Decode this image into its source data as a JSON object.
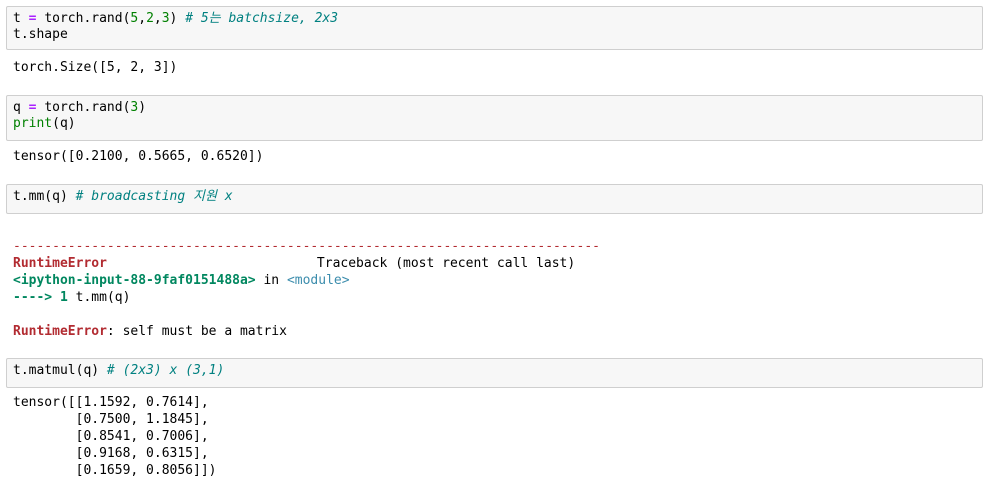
{
  "cells": [
    {
      "input": {
        "line1": {
          "var": "t",
          "eq": "=",
          "call": "torch.rand(",
          "a": "5",
          "c1": ",",
          "b": "2",
          "c2": ",",
          "c": "3",
          "close": ")",
          "comment": "# 5는 batchsize, 2x3"
        },
        "line2": "t.shape"
      },
      "output": "torch.Size([5, 2, 3])"
    },
    {
      "input": {
        "line1": {
          "var": "q",
          "eq": "=",
          "call": "torch.rand(",
          "a": "3",
          "close": ")"
        },
        "line2": {
          "fn": "print",
          "args": "(q)"
        }
      },
      "output": "tensor([0.2100, 0.5665, 0.6520])"
    },
    {
      "input": {
        "code": "t.mm(q)",
        "comment": "# broadcasting 지원 x"
      },
      "error": {
        "separator": "---------------------------------------------------------------------------",
        "name": "RuntimeError",
        "traceback": "Traceback (most recent call last)",
        "location": "<ipython-input-88-9faf0151488a>",
        "in_word": "in",
        "module": "<module>",
        "arrow": "----> 1",
        "arrow_code_a": "t.mm",
        "arrow_code_b": "(q)",
        "message": ": self must be a matrix"
      }
    },
    {
      "input": {
        "code": "t.matmul(q)",
        "comment": "# (2x3) x (3,1)"
      },
      "output_lines": [
        "tensor([[1.1592, 0.7614],",
        "        [0.7500, 1.1845],",
        "        [0.8541, 0.7006],",
        "        [0.9168, 0.6315],",
        "        [0.1659, 0.8056]])"
      ]
    }
  ]
}
